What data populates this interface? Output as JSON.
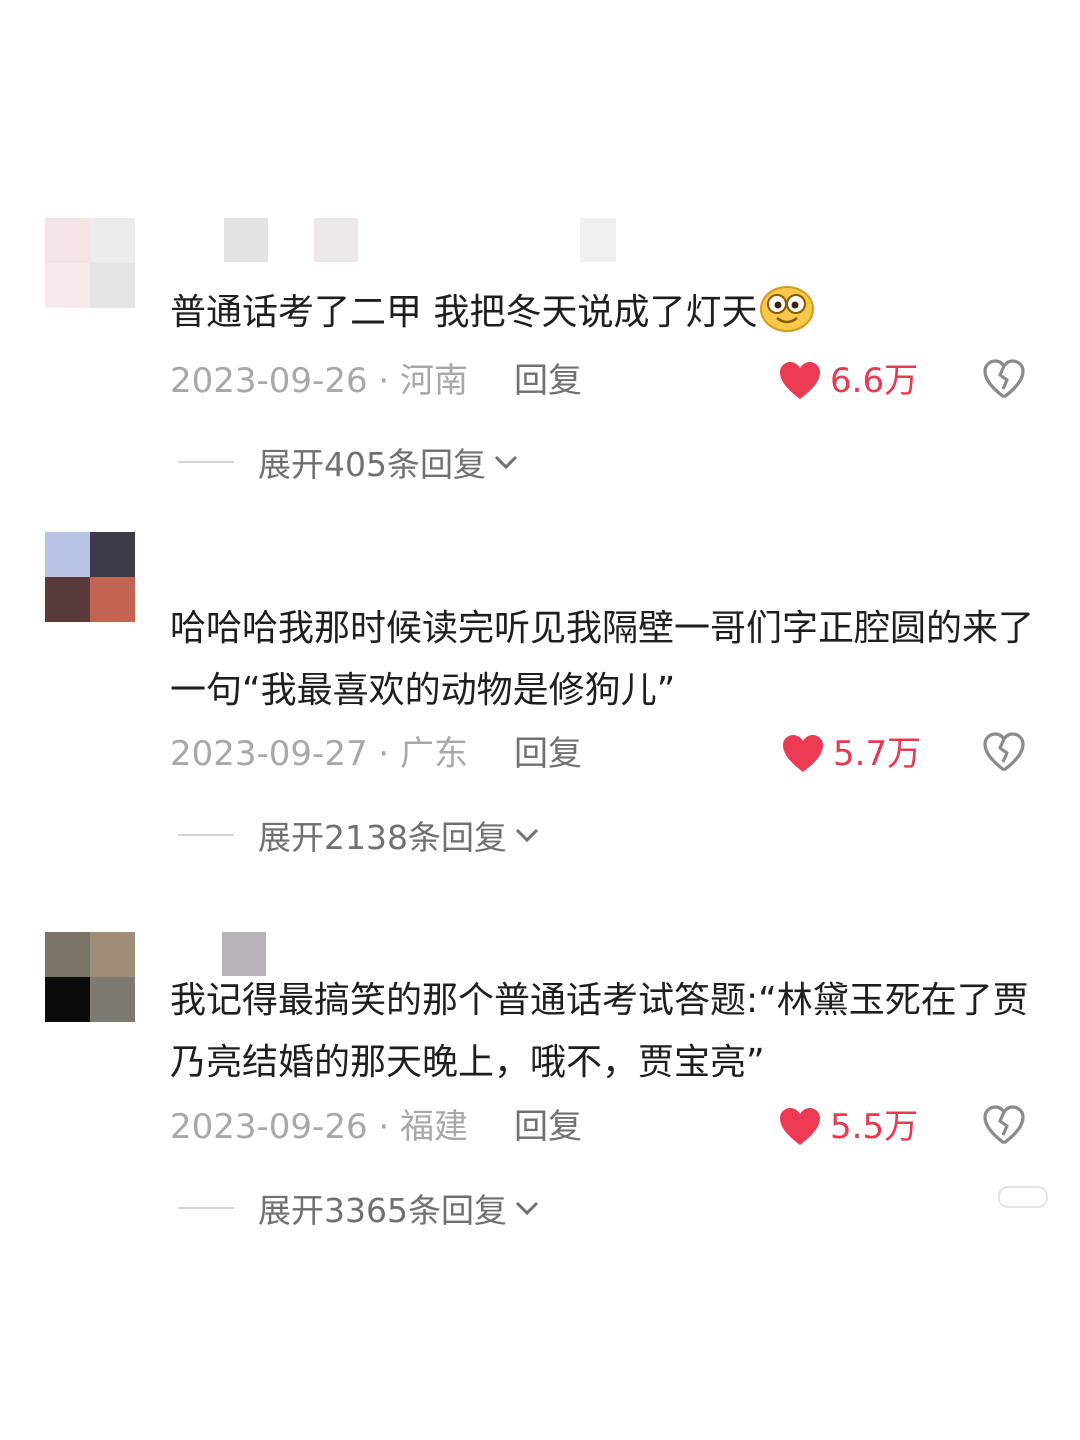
{
  "comments": [
    {
      "text": "普通话考了二甲 我把冬天说成了灯天",
      "emoji": "smile-emoji",
      "date": "2023-09-26",
      "location": "河南",
      "reply_label": "回复",
      "likes": "6.6万",
      "expand_label": "展开405条回复"
    },
    {
      "text": "哈哈哈我那时候读完听见我隔壁一哥们字正腔圆的来了一句“我最喜欢的动物是修狗儿”",
      "date": "2023-09-27",
      "location": "广东",
      "reply_label": "回复",
      "likes": "5.7万",
      "expand_label": "展开2138条回复"
    },
    {
      "text": "我记得最搞笑的那个普通话考试答题:“林黛玉死在了贾乃亮结婚的那天晚上，哦不，贾宝亮”",
      "date": "2023-09-26",
      "location": "福建",
      "reply_label": "回复",
      "likes": "5.5万",
      "expand_label": "展开3365条回复"
    }
  ],
  "separator": "·",
  "colors": {
    "like_red": "#e8394f",
    "meta_gray": "#a8a8a8",
    "reply_gray": "#707070"
  },
  "icons": [
    "heart-filled-icon",
    "broken-heart-icon",
    "chevron-down-icon",
    "smile-emoji"
  ]
}
